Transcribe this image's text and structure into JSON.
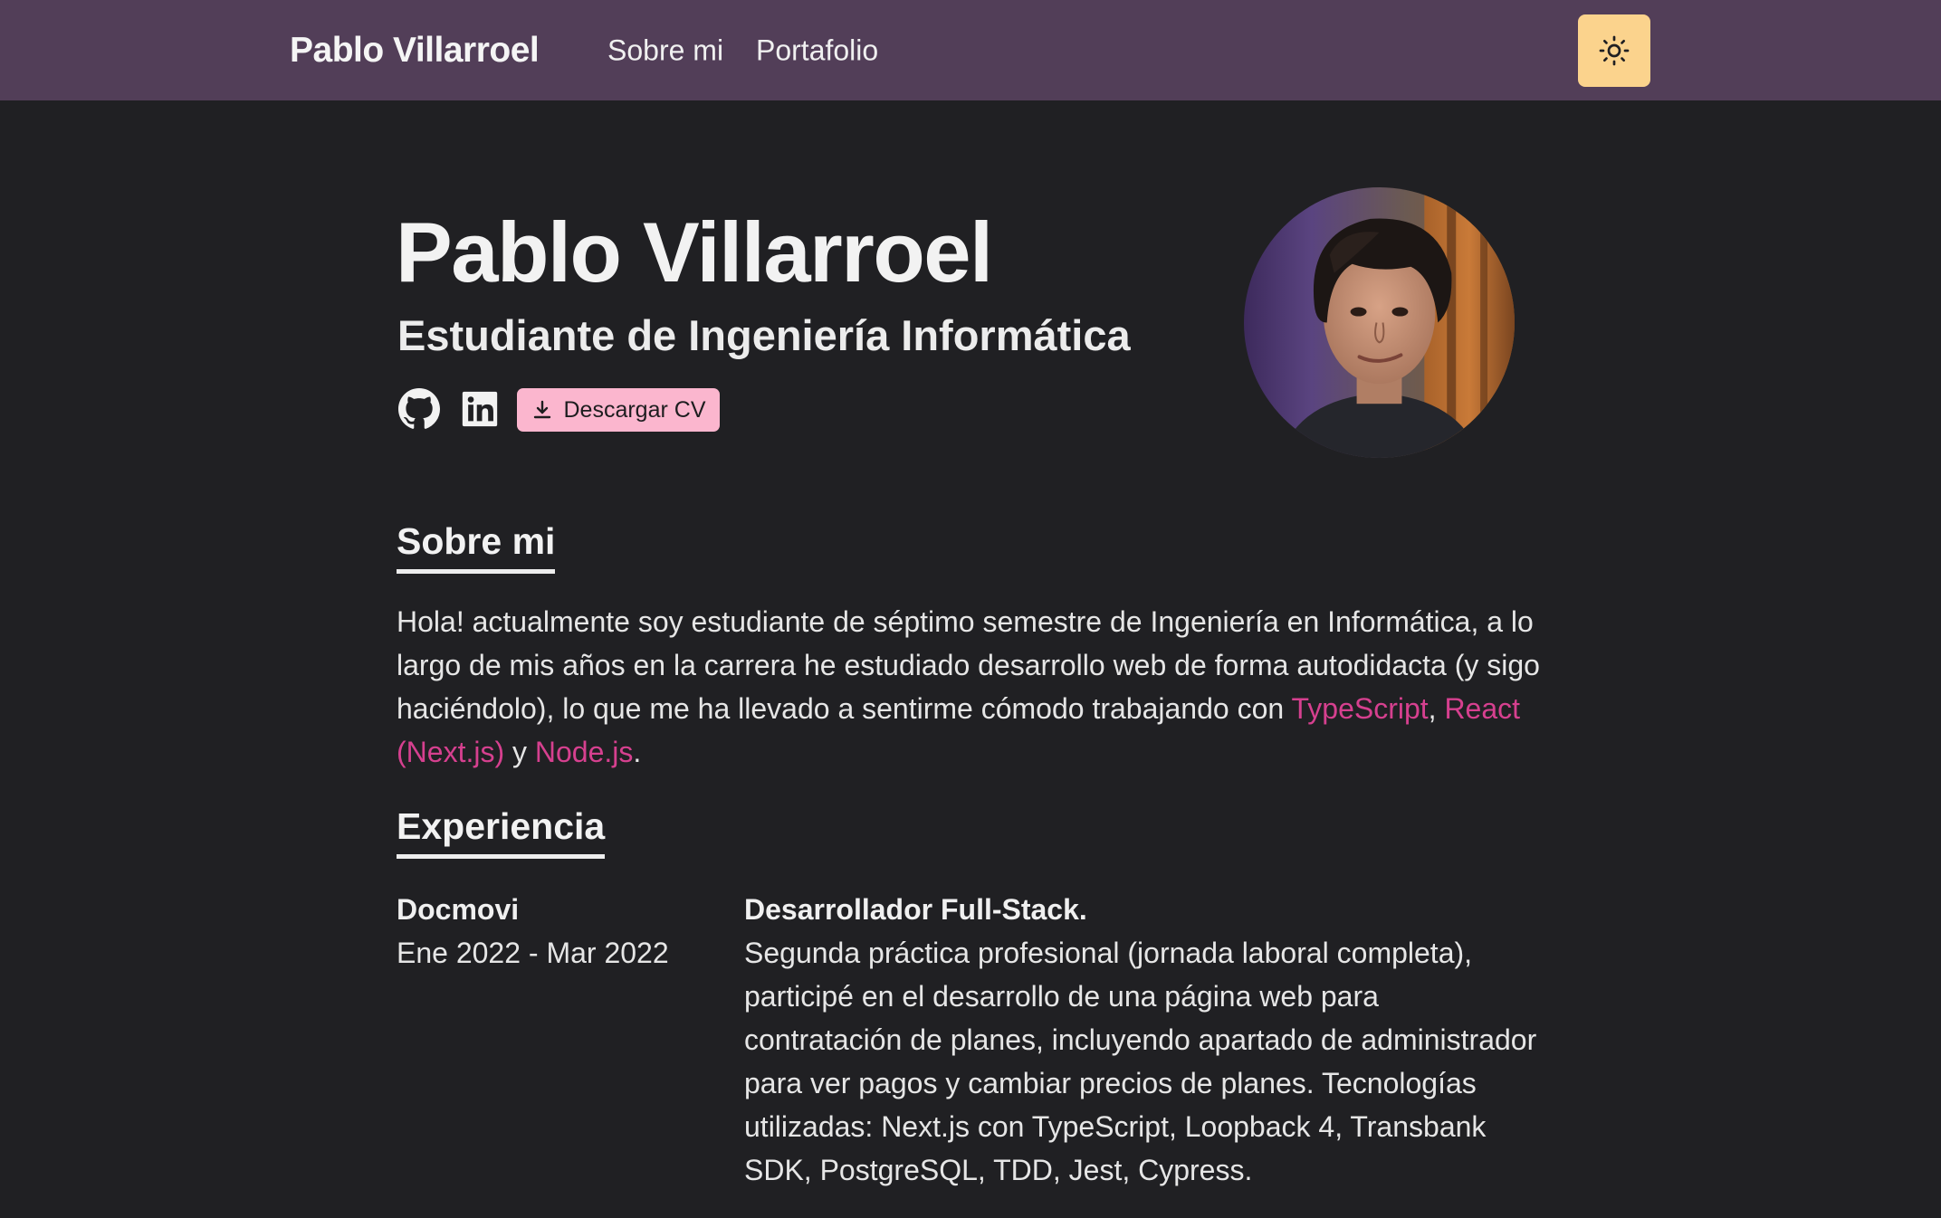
{
  "navbar": {
    "brand": "Pablo Villarroel",
    "links": [
      "Sobre mi",
      "Portafolio"
    ],
    "theme_toggle_icon": "sun-icon"
  },
  "hero": {
    "name": "Pablo Villarroel",
    "role": "Estudiante de Ingeniería Informática",
    "social_icons": [
      "github-icon",
      "linkedin-icon"
    ],
    "cv_button_label": "Descargar CV",
    "cv_button_icon": "download-icon",
    "avatar": "avatar"
  },
  "about": {
    "title": "Sobre mi",
    "text_intro": "Hola! actualmente soy estudiante de séptimo semestre de Ingeniería en Informática, a lo largo de mis años en la carrera he estudiado desarrollo web de forma autodidacta (y sigo haciéndolo), lo que me ha llevado a sentirme cómodo trabajando con ",
    "tech_1": "TypeScript",
    "sep_1": ", ",
    "tech_2": "React (Next.js)",
    "sep_2": " y ",
    "tech_3": "Node.js",
    "end": "."
  },
  "experience": {
    "title": "Experiencia",
    "items": [
      {
        "company": "Docmovi",
        "dates": "Ene 2022 - Mar 2022",
        "role": "Desarrollador Full-Stack.",
        "description": "Segunda práctica profesional (jornada laboral completa), participé en el desarrollo de una página web para contratación de planes, incluyendo apartado de administrador para ver pagos y cambiar precios de planes. Tecnologías utilizadas: Next.js con TypeScript, Loopback 4, Transbank SDK, PostgreSQL, TDD, Jest, Cypress."
      }
    ]
  },
  "colors": {
    "background": "#202023",
    "navbar": "#523e58",
    "accent_pink": "#d6408f",
    "cv_button": "#fbb6ce",
    "theme_button": "#fbd38d"
  }
}
